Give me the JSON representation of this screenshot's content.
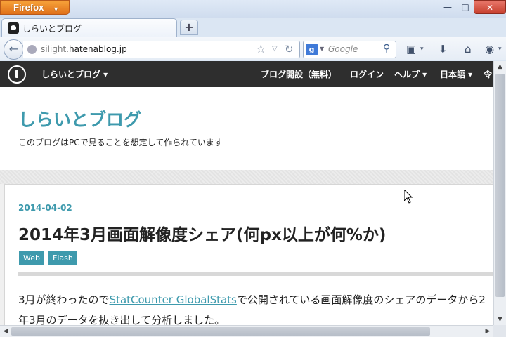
{
  "window": {
    "app_button": "Firefox",
    "min": "—",
    "max": "□",
    "close": "✕"
  },
  "tab": {
    "title": "しらいとブログ",
    "new_tab": "+"
  },
  "navbar": {
    "back": "←",
    "url_host_prefix": "silight.",
    "url_host_main": "hatenablog.jp",
    "star": "☆",
    "dropdown": "▽",
    "reload": "↻",
    "search_engine": "g",
    "search_placeholder": "Google",
    "search_icon": "⚲",
    "bookmarks": "▣",
    "dropdown_small": "▾",
    "download": "⬇",
    "home": "⌂",
    "addon": "◉"
  },
  "globalbar": {
    "blog_menu": "しらいとブログ ▾",
    "start_blog": "ブログ開設（無料）",
    "login": "ログイン",
    "help": "ヘルプ ▾",
    "language": "日本語 ▾",
    "more": "令"
  },
  "blog": {
    "title": "しらいとブログ",
    "description": "このブログはPCで見ることを想定して作られています"
  },
  "entry": {
    "date": "2014-04-02",
    "title": "2014年3月画面解像度シェア(何px以上が何%か)",
    "categories": [
      "Web",
      "Flash"
    ],
    "body_line1_pre": "3月が終わったので",
    "body_line1_link": "StatCounter GlobalStats",
    "body_line1_post": "で公開されている画面解像度のシェアのデータから2",
    "body_line2": "年3月のデータを抜き出して分析しました。"
  },
  "scroll": {
    "up": "▲",
    "down": "▼",
    "left": "◀",
    "right": "▶"
  },
  "colors": {
    "accent": "#3e9aad",
    "globalbar": "#2e2e2e",
    "firefox_orange": "#e0701a"
  }
}
